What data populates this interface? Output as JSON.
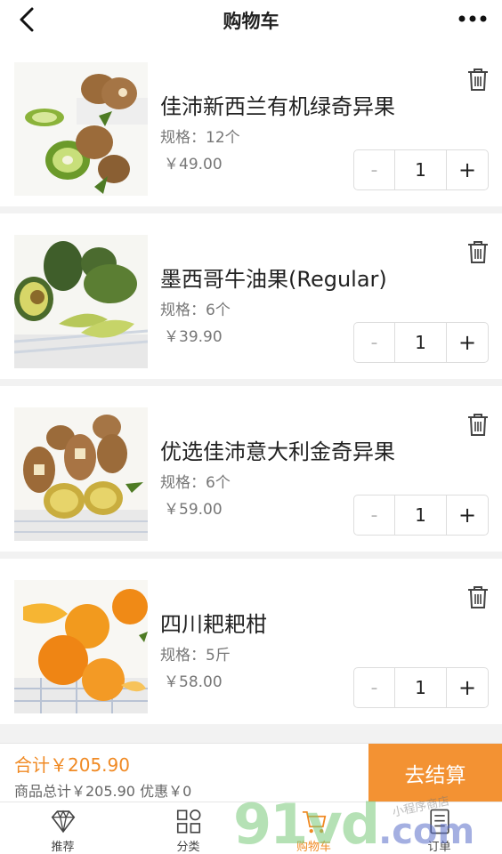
{
  "header": {
    "title": "购物车",
    "back_icon": "chevron-left-icon",
    "more_icon": "more-dots-icon"
  },
  "cart": {
    "items": [
      {
        "name": "佳沛新西兰有机绿奇异果",
        "spec": "规格：12个",
        "price": "￥49.00",
        "qty": "1",
        "minus": "-",
        "plus": "+",
        "image": "kiwi-green"
      },
      {
        "name": "墨西哥牛油果(Regular)",
        "spec": "规格：6个",
        "price": "￥39.90",
        "qty": "1",
        "minus": "-",
        "plus": "+",
        "image": "avocado"
      },
      {
        "name": "优选佳沛意大利金奇异果",
        "spec": "规格：6个",
        "price": "￥59.00",
        "qty": "1",
        "minus": "-",
        "plus": "+",
        "image": "kiwi-gold"
      },
      {
        "name": "四川耙耙柑",
        "spec": "规格：5斤",
        "price": "￥58.00",
        "qty": "1",
        "minus": "-",
        "plus": "+",
        "image": "tangerine"
      }
    ]
  },
  "checkout": {
    "total": "合计￥205.90",
    "subtotal": "商品总计￥205.90   优惠￥0",
    "button": "去结算"
  },
  "tabbar": {
    "tabs": [
      {
        "label": "推荐",
        "icon": "diamond-icon"
      },
      {
        "label": "分类",
        "icon": "grid-icon"
      },
      {
        "label": "购物车",
        "icon": "cart-icon"
      },
      {
        "label": "订单",
        "icon": "order-list-icon"
      }
    ]
  },
  "watermark": {
    "main": "91vd",
    "suffix": ".com",
    "sub": "小程序商店"
  },
  "colors": {
    "accent": "#f08a24",
    "checkout_bg": "#f39233"
  }
}
